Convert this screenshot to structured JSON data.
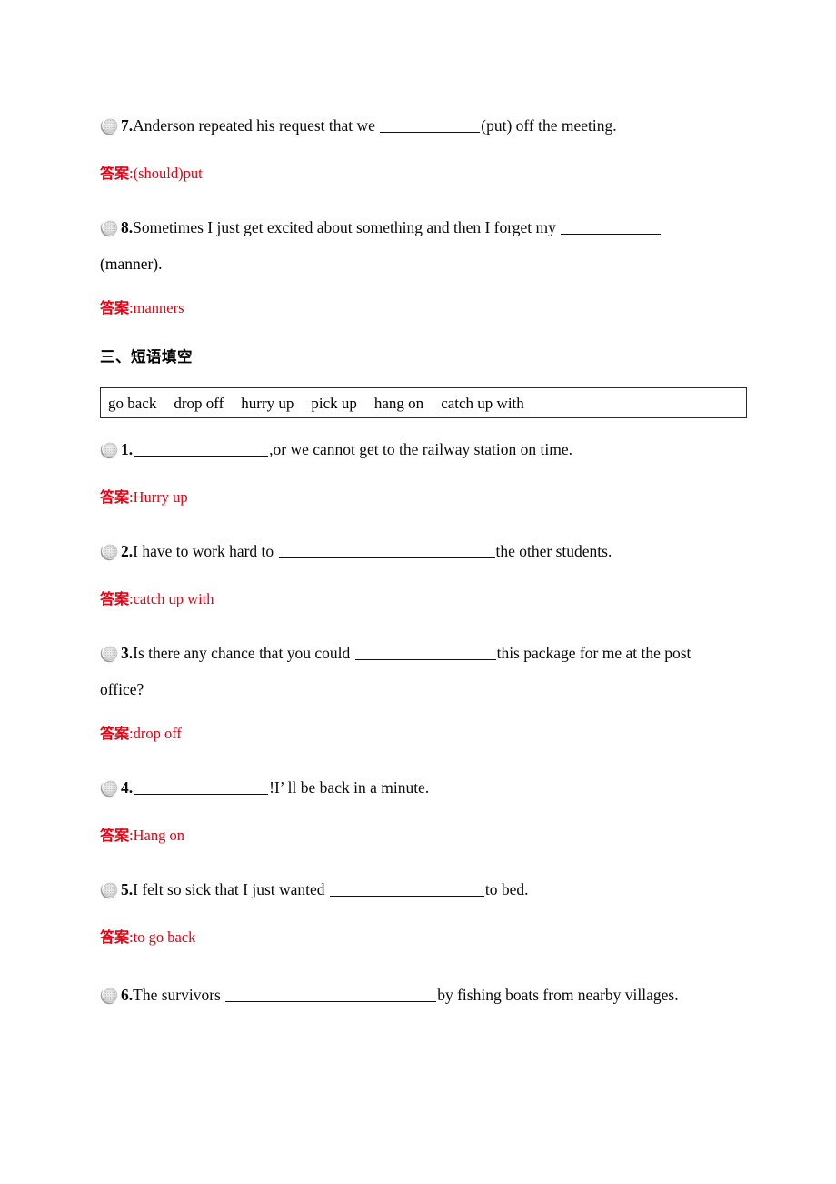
{
  "document": {
    "answer_label": "答案",
    "answer_separator": ":",
    "accent_red": "#e60012",
    "bullet_icon": "crescent-sphere-bullet"
  },
  "items_top": [
    {
      "number": "7.",
      "text_before": "Anderson repeated his request that we ",
      "blank_width": 110,
      "text_after": "(put) off the meeting.",
      "answer": "(should)put"
    },
    {
      "number": "8.",
      "text_before": "Sometimes I just get excited about something and then I forget my ",
      "blank_width": 110,
      "text_after": "",
      "continuation": "(manner).",
      "answer": "manners"
    }
  ],
  "section": {
    "heading": "三、短语填空",
    "wordbank": [
      "go back",
      "drop off",
      "hurry up",
      "pick up",
      "hang on",
      "catch up with"
    ]
  },
  "items_phrase": [
    {
      "number": "1.",
      "text_before": "",
      "blank_width": 148,
      "text_after": ",or we cannot get to the railway station on time.",
      "answer": "Hurry up"
    },
    {
      "number": "2.",
      "text_before": "I have to work hard to ",
      "blank_width": 238,
      "text_after": "the other students.",
      "answer": "catch up with"
    },
    {
      "number": "3.",
      "text_before": "Is there any chance that you could ",
      "blank_width": 155,
      "text_after": "this package for me at the post",
      "continuation": "office?",
      "answer": "drop off"
    },
    {
      "number": "4.",
      "text_before": "",
      "blank_width": 148,
      "text_after": "!I’ ll be back in a minute.",
      "answer": "Hang on"
    },
    {
      "number": "5.",
      "text_before": "I felt so sick that I just wanted ",
      "blank_width": 170,
      "text_after": "to bed.",
      "answer": "to go back"
    },
    {
      "number": "6.",
      "text_before": "The survivors ",
      "blank_width": 232,
      "text_after": "by fishing boats from nearby villages.",
      "answer": ""
    }
  ]
}
